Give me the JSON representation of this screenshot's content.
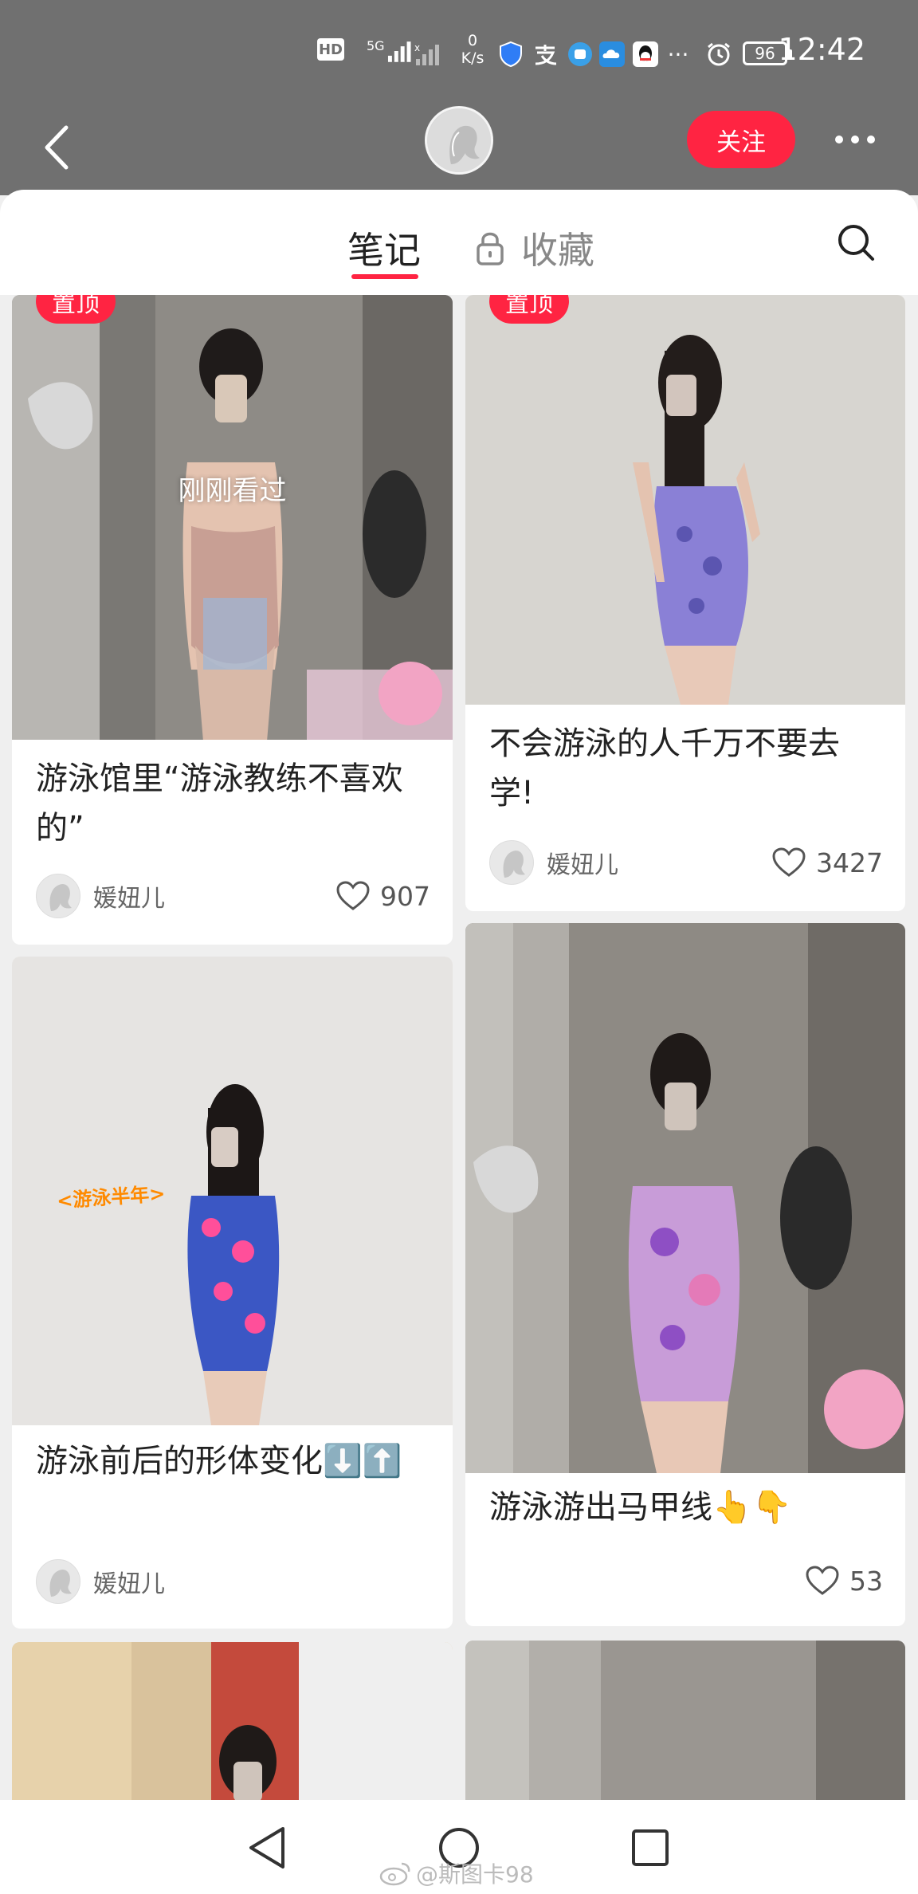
{
  "status_bar": {
    "hd": "HD",
    "signal": "5G",
    "net_rate_value": "0",
    "net_rate_unit": "K/s",
    "battery": "96",
    "time": "12:42",
    "icons": [
      "shield-icon",
      "alipay-icon",
      "app-icon",
      "cloud-icon",
      "qq-icon",
      "more-dots-icon",
      "alarm-icon"
    ]
  },
  "header": {
    "follow_label": "关注"
  },
  "tabs": {
    "notes": "笔记",
    "collect": "收藏"
  },
  "cards": [
    {
      "badge": "置顶",
      "viewed_label": "刚刚看过",
      "title": "游泳馆里“游泳教练不喜欢的”",
      "author": "媛妞儿",
      "likes": "907"
    },
    {
      "badge": "置顶",
      "title": "不会游泳的人千万不要去学!",
      "author": "媛妞儿",
      "likes": "3427"
    },
    {
      "image_text": "<游泳半年>",
      "title": "游泳前后的形体变化⬇️⬆️",
      "author": "媛妞儿"
    },
    {
      "title": "游泳游出马甲线👆👇",
      "likes": "53"
    }
  ],
  "watermark": "@斯图卡98",
  "colors": {
    "accent": "#ff2442",
    "header_bg": "#707070",
    "page_bg": "#efefef"
  }
}
